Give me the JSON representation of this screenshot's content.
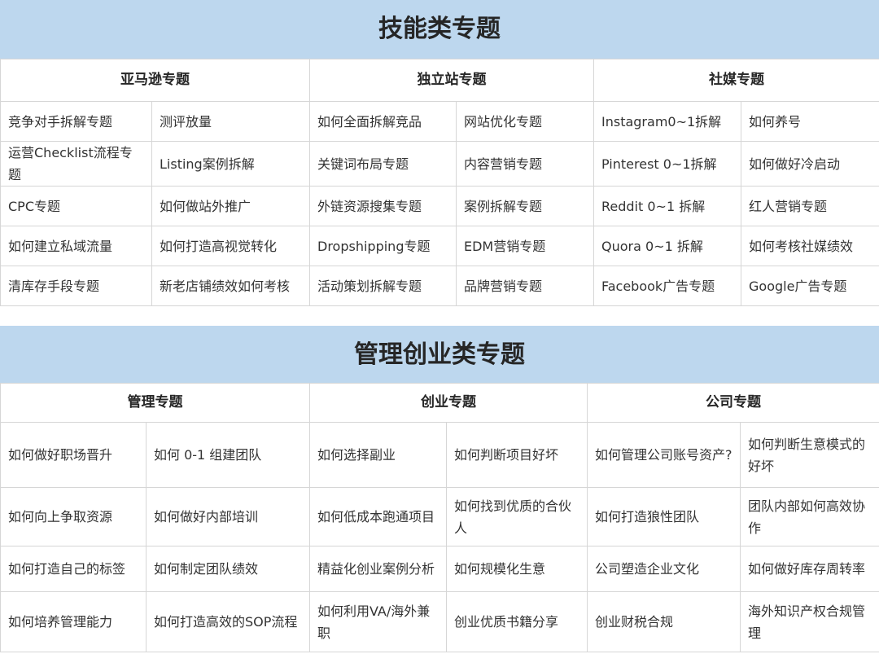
{
  "skills": {
    "title": "技能类专题",
    "headers": [
      "亚马逊专题",
      "独立站专题",
      "社媒专题"
    ],
    "rows": [
      [
        "竞争对手拆解专题",
        "测评放量",
        "如何全面拆解竞品",
        "网站优化专题",
        "Instagram0~1拆解",
        "如何养号"
      ],
      [
        "运营Checklist流程专题",
        "Listing案例拆解",
        "关键词布局专题",
        "内容营销专题",
        "Pinterest 0~1拆解",
        "如何做好冷启动"
      ],
      [
        "CPC专题",
        "如何做站外推广",
        "外链资源搜集专题",
        "案例拆解专题",
        "Reddit 0~1 拆解",
        "红人营销专题"
      ],
      [
        "如何建立私域流量",
        "如何打造高视觉转化",
        "Dropshipping专题",
        "EDM营销专题",
        "Quora 0~1 拆解",
        "如何考核社媒绩效"
      ],
      [
        "清库存手段专题",
        "新老店铺绩效如何考核",
        "活动策划拆解专题",
        "品牌营销专题",
        "Facebook广告专题",
        "Google广告专题"
      ]
    ]
  },
  "management": {
    "title": "管理创业类专题",
    "headers": [
      "管理专题",
      "创业专题",
      "公司专题"
    ],
    "rows": [
      [
        "如何做好职场晋升",
        "如何 0-1 组建团队",
        "如何选择副业",
        "如何判断项目好坏",
        "如何管理公司账号资产?",
        "如何判断生意模式的好坏"
      ],
      [
        "如何向上争取资源",
        "如何做好内部培训",
        "如何低成本跑通项目",
        "如何找到优质的合伙人",
        "如何打造狼性团队",
        "团队内部如何高效协作"
      ],
      [
        "如何打造自己的标签",
        "如何制定团队绩效",
        "精益化创业案例分析",
        "如何规模化生意",
        "公司塑造企业文化",
        "如何做好库存周转率"
      ],
      [
        "如何培养管理能力",
        "如何打造高效的SOP流程",
        "如何利用VA/海外兼职",
        "创业优质书籍分享",
        "创业财税合规",
        "海外知识产权合规管理"
      ]
    ]
  },
  "colors": {
    "banner": "#bdd7ee",
    "border": "#d6d6d6",
    "text": "#333333"
  }
}
